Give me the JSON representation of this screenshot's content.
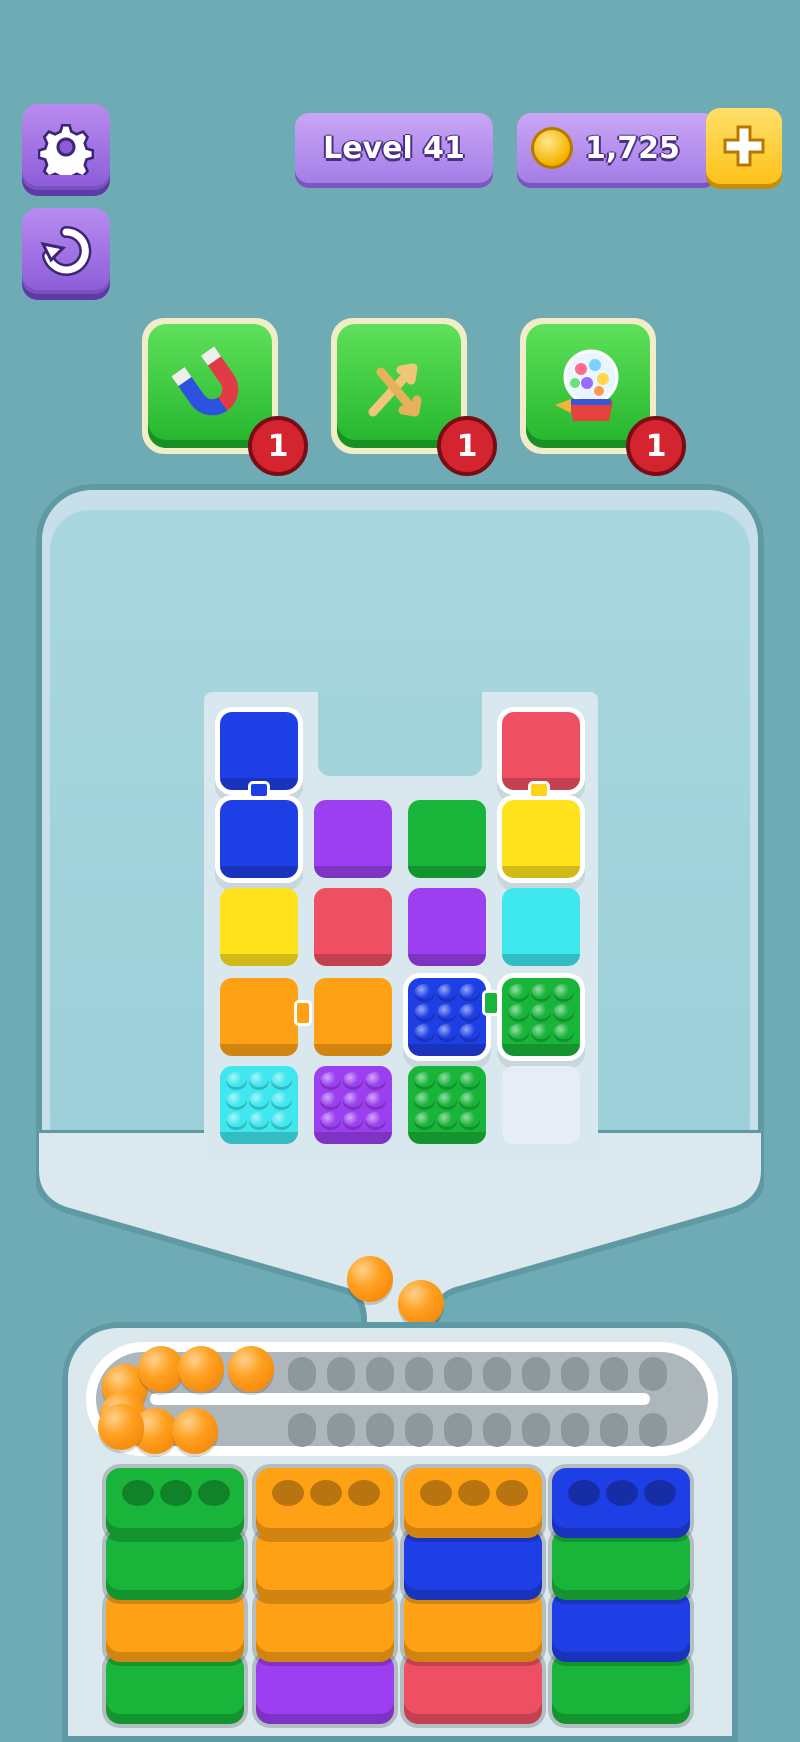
{
  "header": {
    "level_label": "Level 41",
    "coins": "1,725"
  },
  "icons": {
    "settings": "gear-icon",
    "restart": "restart-icon",
    "coin": "coin-icon",
    "add": "plus-icon"
  },
  "boosters": [
    {
      "name": "magnet",
      "icon": "magnet-icon",
      "count": "1"
    },
    {
      "name": "shuffle",
      "icon": "shuffle-arrows-icon",
      "count": "1"
    },
    {
      "name": "gumball",
      "icon": "gumball-machine-icon",
      "count": "1"
    }
  ],
  "colors": {
    "blue": "#1f3fe6",
    "red": "#ef4f63",
    "purple": "#9b3ff0",
    "green": "#19b53a",
    "yellow": "#ffe21c",
    "cyan": "#3fe7ee",
    "orange": "#ffa114",
    "empty": "#e6edf5"
  },
  "board": {
    "tiles": [
      {
        "row": 0,
        "col": 0,
        "color": "blue"
      },
      {
        "row": 0,
        "col": 3,
        "color": "red"
      },
      {
        "row": 1,
        "col": 0,
        "color": "blue"
      },
      {
        "row": 1,
        "col": 1,
        "color": "purple"
      },
      {
        "row": 1,
        "col": 2,
        "color": "green"
      },
      {
        "row": 1,
        "col": 3,
        "color": "yellow"
      },
      {
        "row": 2,
        "col": 0,
        "color": "yellow"
      },
      {
        "row": 2,
        "col": 1,
        "color": "red"
      },
      {
        "row": 2,
        "col": 2,
        "color": "purple"
      },
      {
        "row": 2,
        "col": 3,
        "color": "cyan"
      },
      {
        "row": 3,
        "col": 0,
        "color": "orange"
      },
      {
        "row": 3,
        "col": 1,
        "color": "orange"
      },
      {
        "row": 3,
        "col": 2,
        "color": "blue",
        "balls": true
      },
      {
        "row": 3,
        "col": 3,
        "color": "green",
        "balls": true
      },
      {
        "row": 4,
        "col": 0,
        "color": "cyan",
        "balls": true
      },
      {
        "row": 4,
        "col": 1,
        "color": "purple",
        "balls": true
      },
      {
        "row": 4,
        "col": 2,
        "color": "green",
        "balls": true
      },
      {
        "row": 4,
        "col": 3,
        "color": "empty"
      }
    ]
  },
  "conveyor": {
    "marble_color": "orange",
    "marbles_on_belt": 8,
    "falling_marbles": 2
  },
  "containers": [
    {
      "colors": [
        "green",
        "green",
        "orange",
        "green"
      ]
    },
    {
      "colors": [
        "orange",
        "orange",
        "orange",
        "purple"
      ]
    },
    {
      "colors": [
        "orange",
        "blue",
        "orange",
        "red"
      ]
    },
    {
      "colors": [
        "blue",
        "green",
        "blue",
        "green"
      ]
    }
  ]
}
